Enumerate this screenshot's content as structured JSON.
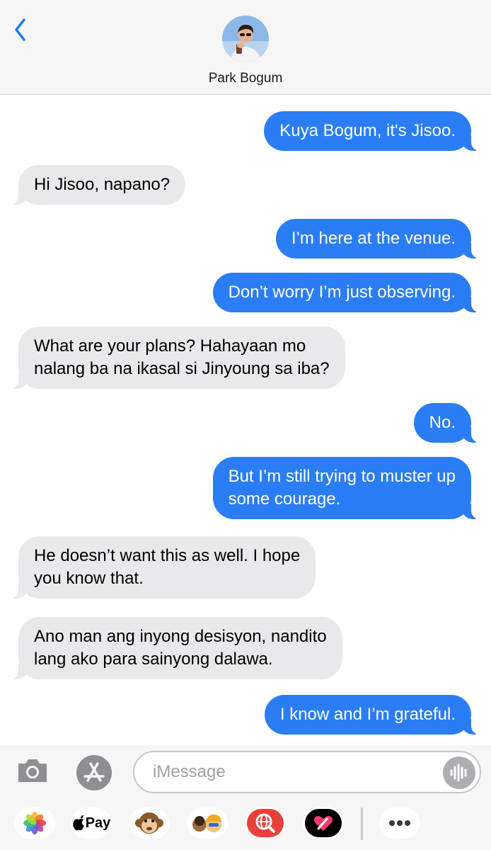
{
  "header": {
    "contact_name": "Park Bogum"
  },
  "messages": [
    {
      "dir": "out",
      "lines": [
        "Kuya Bogum, it's Jisoo."
      ]
    },
    {
      "dir": "in",
      "lines": [
        "Hi Jisoo, napano?"
      ]
    },
    {
      "dir": "out",
      "lines": [
        "I’m here at the venue."
      ]
    },
    {
      "dir": "out",
      "lines": [
        "Don’t worry I’m just observing."
      ]
    },
    {
      "dir": "in",
      "lines": [
        "What are your plans? Hahayaan mo",
        "nalang ba na ikasal si Jinyoung sa iba?"
      ]
    },
    {
      "dir": "out",
      "lines": [
        "No."
      ]
    },
    {
      "dir": "out",
      "lines": [
        "But I’m still trying to muster up",
        "some courage."
      ]
    },
    {
      "dir": "in",
      "lines": [
        "He doesn’t want this as well. I hope",
        "you know that."
      ]
    },
    {
      "dir": "in",
      "lines": [
        "Ano man ang inyong desisyon, nandito",
        "lang ako para sainyong dalawa."
      ]
    },
    {
      "dir": "out",
      "lines": [
        "I know and I’m grateful."
      ]
    }
  ],
  "composer": {
    "placeholder": "iMessage",
    "apple_pay_label": "Pay"
  },
  "colors": {
    "outgoing_bubble": "#2b7df6",
    "incoming_bubble": "#e9e9eb",
    "ios_blue": "#1e7cf2"
  },
  "icons": [
    "back-chevron-icon",
    "camera-icon",
    "app-store-icon",
    "audio-waveform-icon",
    "photos-icon",
    "apple-pay-icon",
    "monkey-animoji-icon",
    "memoji-icon",
    "web-search-icon",
    "heart-digital-touch-icon",
    "more-icon"
  ]
}
